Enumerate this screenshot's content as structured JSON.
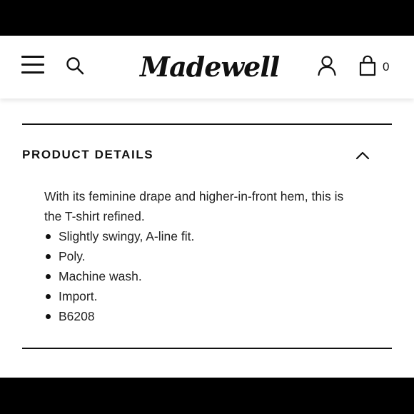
{
  "header": {
    "logo_text": "Madewell",
    "bag_count": "0",
    "icons": [
      "hamburger-menu-icon",
      "search-icon",
      "account-icon",
      "shopping-bag-icon"
    ]
  },
  "product_details": {
    "title": "PRODUCT DETAILS",
    "expanded": true,
    "intro": "With its feminine drape and higher-in-front hem, this is the T-shirt refined.",
    "bullets": [
      "Slightly swingy, A-line fit.",
      "Poly.",
      "Machine wash.",
      "Import.",
      "B6208"
    ]
  },
  "colors": {
    "text": "#111111",
    "background": "#ffffff",
    "letterbox": "#000000"
  }
}
